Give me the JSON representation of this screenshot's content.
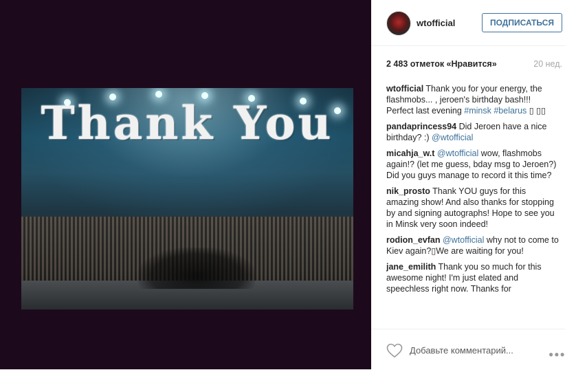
{
  "photo": {
    "overlay_text": "Thank You"
  },
  "header": {
    "username": "wtofficial",
    "follow_label": "ПОДПИСАТЬСЯ"
  },
  "stats": {
    "likes": "2 483 отметок «Нравится»",
    "age": "20 нед."
  },
  "comments": [
    {
      "author": "wtofficial",
      "segments": [
        {
          "text": "Thank you for your energy, the flashmobs... , jeroen's birthday bash!!! Perfect last evening ",
          "link": false
        },
        {
          "text": "#minsk",
          "link": true
        },
        {
          "text": " ",
          "link": false
        },
        {
          "text": "#belarus",
          "link": true
        },
        {
          "text": " ▯ ▯▯",
          "link": false
        }
      ]
    },
    {
      "author": "pandaprincess94",
      "segments": [
        {
          "text": "Did Jeroen have a nice birthday? :) ",
          "link": false
        },
        {
          "text": "@wtofficial",
          "link": true
        }
      ]
    },
    {
      "author": "micahja_w.t",
      "segments": [
        {
          "text": "@wtofficial",
          "link": true
        },
        {
          "text": " wow, flashmobs again!? (let me guess, bday msg to Jeroen?) Did you guys manage to record it this time?",
          "link": false
        }
      ]
    },
    {
      "author": "nik_prosto",
      "segments": [
        {
          "text": "Thank YOU guys for this amazing show! And also thanks for stopping by and signing autographs! Hope to see you in Minsk very soon indeed!",
          "link": false
        }
      ]
    },
    {
      "author": "rodion_evfan",
      "segments": [
        {
          "text": "@wtofficial",
          "link": true
        },
        {
          "text": " why not to come to Kiev again?▯We are waiting for you!",
          "link": false
        }
      ]
    },
    {
      "author": "jane_emilith",
      "segments": [
        {
          "text": "Thank you so much for this awesome night! I'm just elated and speechless right now. Thanks for",
          "link": false
        }
      ]
    }
  ],
  "footer": {
    "add_comment_placeholder": "Добавьте комментарий...",
    "more_icon": "ellipsis-icon",
    "like_icon": "heart-icon"
  },
  "colors": {
    "link": "#3f729b",
    "left_background": "#1c0a1c"
  }
}
